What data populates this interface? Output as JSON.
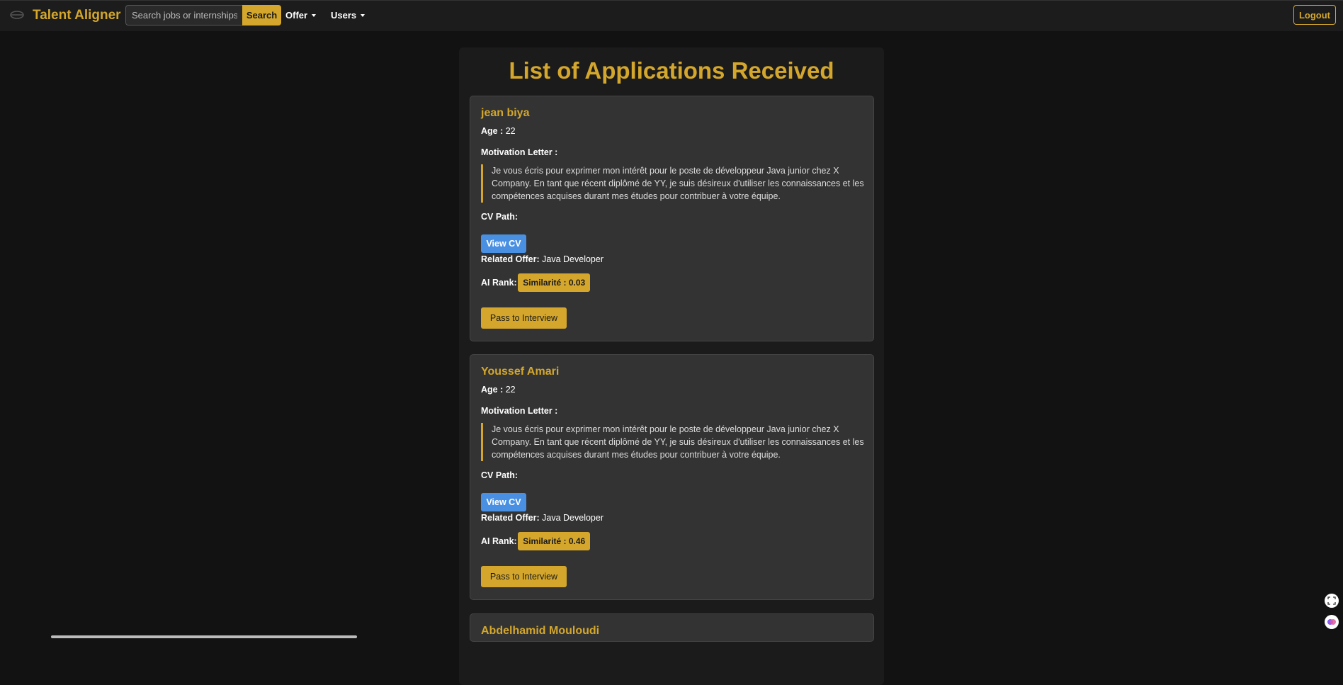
{
  "navbar": {
    "brand": "Talent Aligner",
    "search_placeholder": "Search jobs or internships",
    "search_label": "Search",
    "menu": [
      "Offer",
      "Users"
    ],
    "logout_label": "Logout"
  },
  "page": {
    "title": "List of Applications Received"
  },
  "labels": {
    "age": "Age :",
    "motivation": "Motivation Letter :",
    "cv_path": "CV Path:",
    "view_cv": "View CV",
    "related_offer": "Related Offer:",
    "ai_rank": "AI Rank:",
    "pass": "Pass to Interview"
  },
  "applications": [
    {
      "name": "jean biya",
      "age": "22",
      "letter": "Je vous écris pour exprimer mon intérêt pour le poste de développeur Java junior chez X Company. En tant que récent diplômé de YY, je suis désireux d'utiliser les connaissances et les compétences acquises durant mes études pour contribuer à votre équipe.",
      "offer": "Java Developer",
      "similarity": "Similarité : 0.03"
    },
    {
      "name": "Youssef Amari",
      "age": "22",
      "letter": "Je vous écris pour exprimer mon intérêt pour le poste de développeur Java junior chez X Company. En tant que récent diplômé de YY, je suis désireux d'utiliser les connaissances et les compétences acquises durant mes études pour contribuer à votre équipe.",
      "offer": "Java Developer",
      "similarity": "Similarité : 0.46"
    },
    {
      "name": "Abdelhamid Mouloudi"
    }
  ],
  "colors": {
    "accent": "#d4a72c",
    "cv_button": "#4a90e2",
    "background": "#121212",
    "card": "#333333"
  }
}
